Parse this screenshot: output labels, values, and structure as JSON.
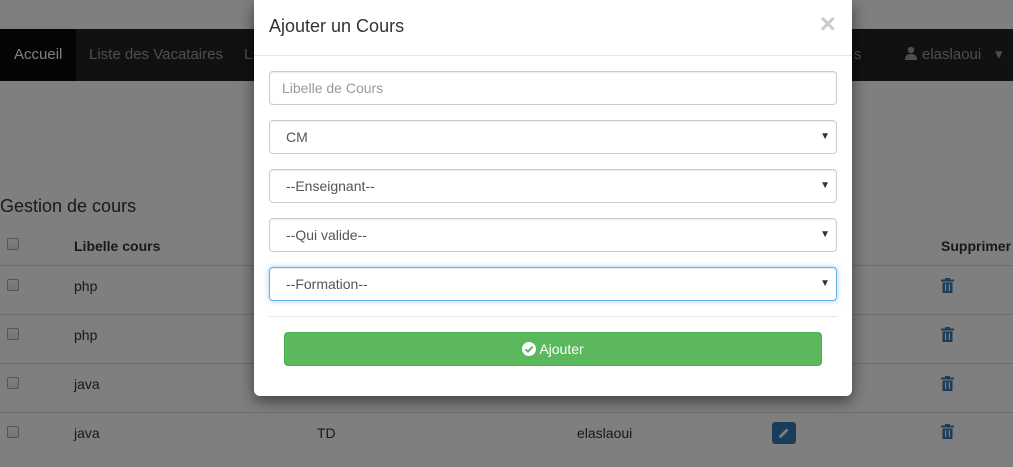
{
  "navbar": {
    "home": "Accueil",
    "vacataires": "Liste des Vacataires",
    "partial_left": "L",
    "partial_right": "s",
    "user": "elaslaoui"
  },
  "page": {
    "title": "Gestion de cours",
    "columns": {
      "libelle": "Libelle cours",
      "supprimer": "Supprimer"
    },
    "rows": [
      {
        "libelle": "php",
        "type": "",
        "enseignant": ""
      },
      {
        "libelle": "php",
        "type": "",
        "enseignant": ""
      },
      {
        "libelle": "java",
        "type": "",
        "enseignant": ""
      },
      {
        "libelle": "java",
        "type": "TD",
        "enseignant": "elaslaoui"
      }
    ]
  },
  "modal": {
    "title": "Ajouter un Cours",
    "close": "×",
    "libelle_placeholder": "Libelle de Cours",
    "type_value": "CM",
    "enseignant_value": "--Enseignant--",
    "valide_value": "--Qui valide--",
    "formation_value": "--Formation--",
    "submit_label": "Ajouter"
  },
  "colors": {
    "success": "#5cb85c",
    "primary": "#337ab7",
    "navbar": "#222222"
  },
  "icons": [
    "user-icon",
    "trash-icon",
    "pencil-icon",
    "check-circle-icon",
    "close-icon",
    "caret-down-icon"
  ]
}
